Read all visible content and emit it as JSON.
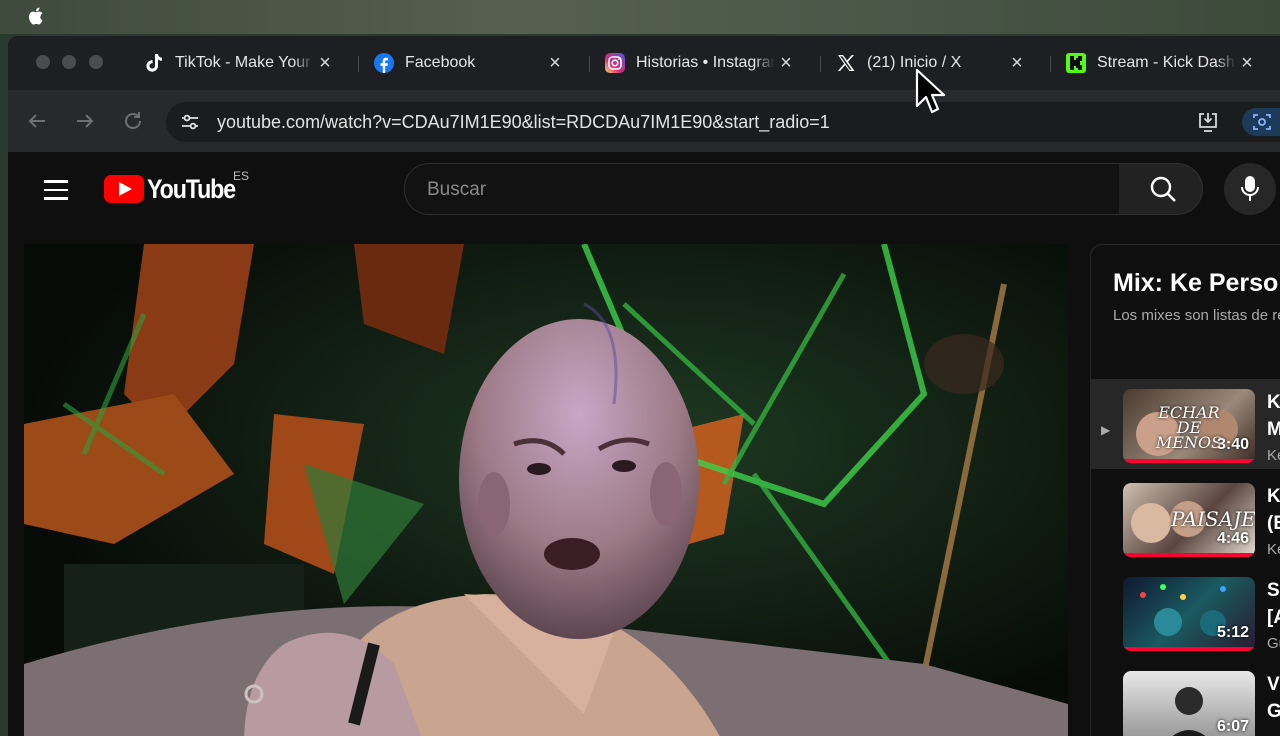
{
  "browser": {
    "tabs": [
      {
        "title": "TikTok - Make Your Day",
        "icon": "tiktok-icon"
      },
      {
        "title": "Facebook",
        "icon": "facebook-icon"
      },
      {
        "title": "Historias • Instagram",
        "icon": "instagram-icon"
      },
      {
        "title": "(21) Inicio / X",
        "icon": "x-icon"
      },
      {
        "title": "Stream - Kick Dashboard",
        "icon": "kick-icon"
      }
    ],
    "url": "youtube.com/watch?v=CDAu7IM1E90&list=RDCDAu7IM1E90&start_radio=1"
  },
  "youtube": {
    "logo_text": "YouTube",
    "country_code": "ES",
    "search_placeholder": "Buscar"
  },
  "playlist": {
    "title": "Mix: Ke Personajes",
    "subtitle": "Los mixes son listas de reproducción",
    "items": [
      {
        "title_l1": "Ke",
        "title_l2": "M",
        "channel": "Ke",
        "duration": "3:40",
        "thumb_text": "ECHAR DE MENOS",
        "progress": 1.0,
        "playing": true
      },
      {
        "title_l1": "Ke",
        "title_l2": "(E",
        "channel": "Ke",
        "duration": "4:46",
        "thumb_text": "PAISAJE",
        "progress": 1.0,
        "playing": false
      },
      {
        "title_l1": "Sl",
        "title_l2": "[A",
        "channel": "Gu",
        "duration": "5:12",
        "thumb_text": "",
        "progress": 1.0,
        "playing": false
      },
      {
        "title_l1": "V",
        "title_l2": "G",
        "channel": "",
        "duration": "6:07",
        "thumb_text": "",
        "progress": 0,
        "playing": false
      }
    ]
  },
  "colors": {
    "youtube_red": "#ff0000",
    "progress_red": "#ff0033"
  }
}
